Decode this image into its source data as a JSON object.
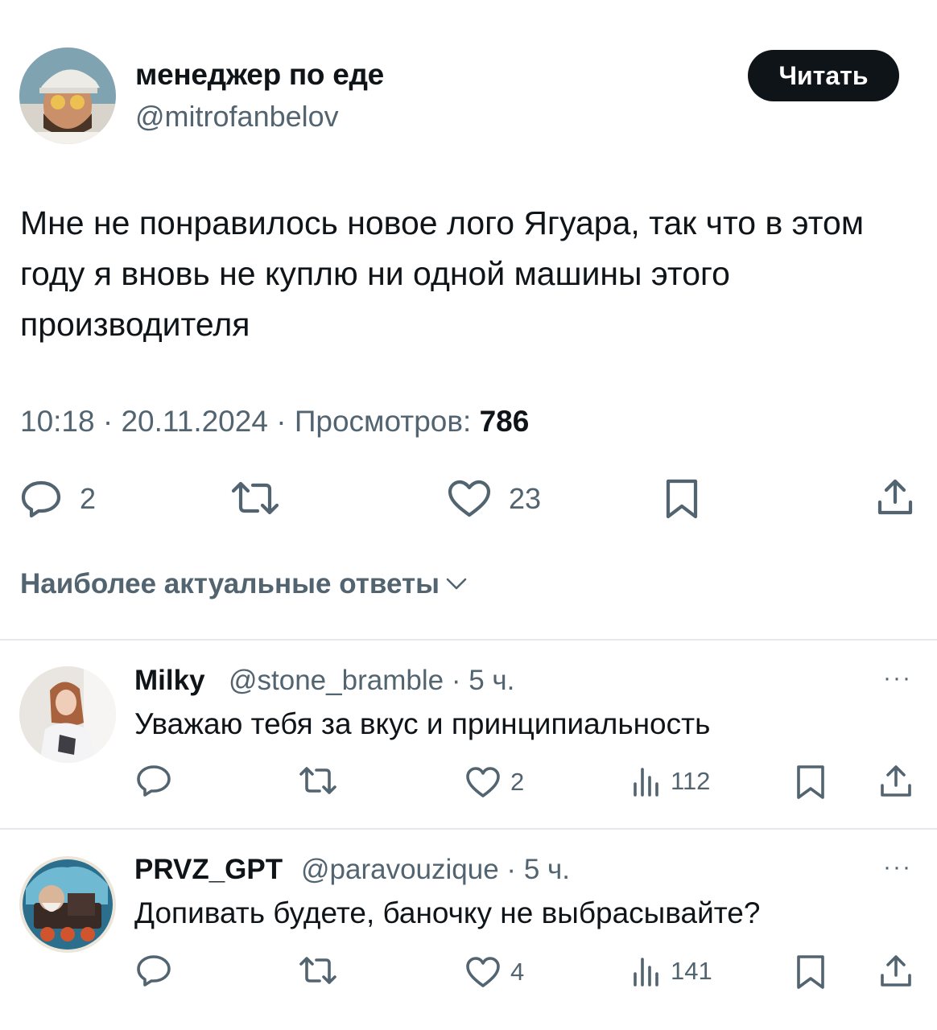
{
  "tweet": {
    "author_name": "менеджер по еде",
    "author_handle": "@mitrofanbelov",
    "follow_label": "Читать",
    "text": "Мне не понравилось новое лого Ягуара, так что в этом году я вновь не куплю ни одной машины этого производителя",
    "time": "10:18",
    "date": "20.11.2024",
    "views_label": "Просмотров:",
    "views_count": "786",
    "separator": "·",
    "actions": {
      "reply_icon": "reply-icon",
      "reply_count": "2",
      "retweet_icon": "retweet-icon",
      "like_icon": "heart-icon",
      "like_count": "23",
      "bookmark_icon": "bookmark-icon",
      "share_icon": "share-icon"
    }
  },
  "replies_sort": {
    "label": "Наиболее актуальные ответы",
    "icon": "chevron-down-icon"
  },
  "replies": [
    {
      "name": "Milky",
      "handle": "@stone_bramble",
      "time": "5 ч.",
      "text": "Уважаю тебя за вкус и принципиальность",
      "likes": "2",
      "views": "112",
      "more": "···"
    },
    {
      "name": "PRVZ_GPT",
      "handle": "@paravouzique",
      "time": "5 ч.",
      "text": "Допивать будете, баночку не выбрасывайте?",
      "likes": "4",
      "views": "141",
      "more": "···"
    }
  ],
  "colors": {
    "text": "#0f1419",
    "secondary": "#536471",
    "divider": "#e4e8ec",
    "button_bg": "#0f1419"
  }
}
